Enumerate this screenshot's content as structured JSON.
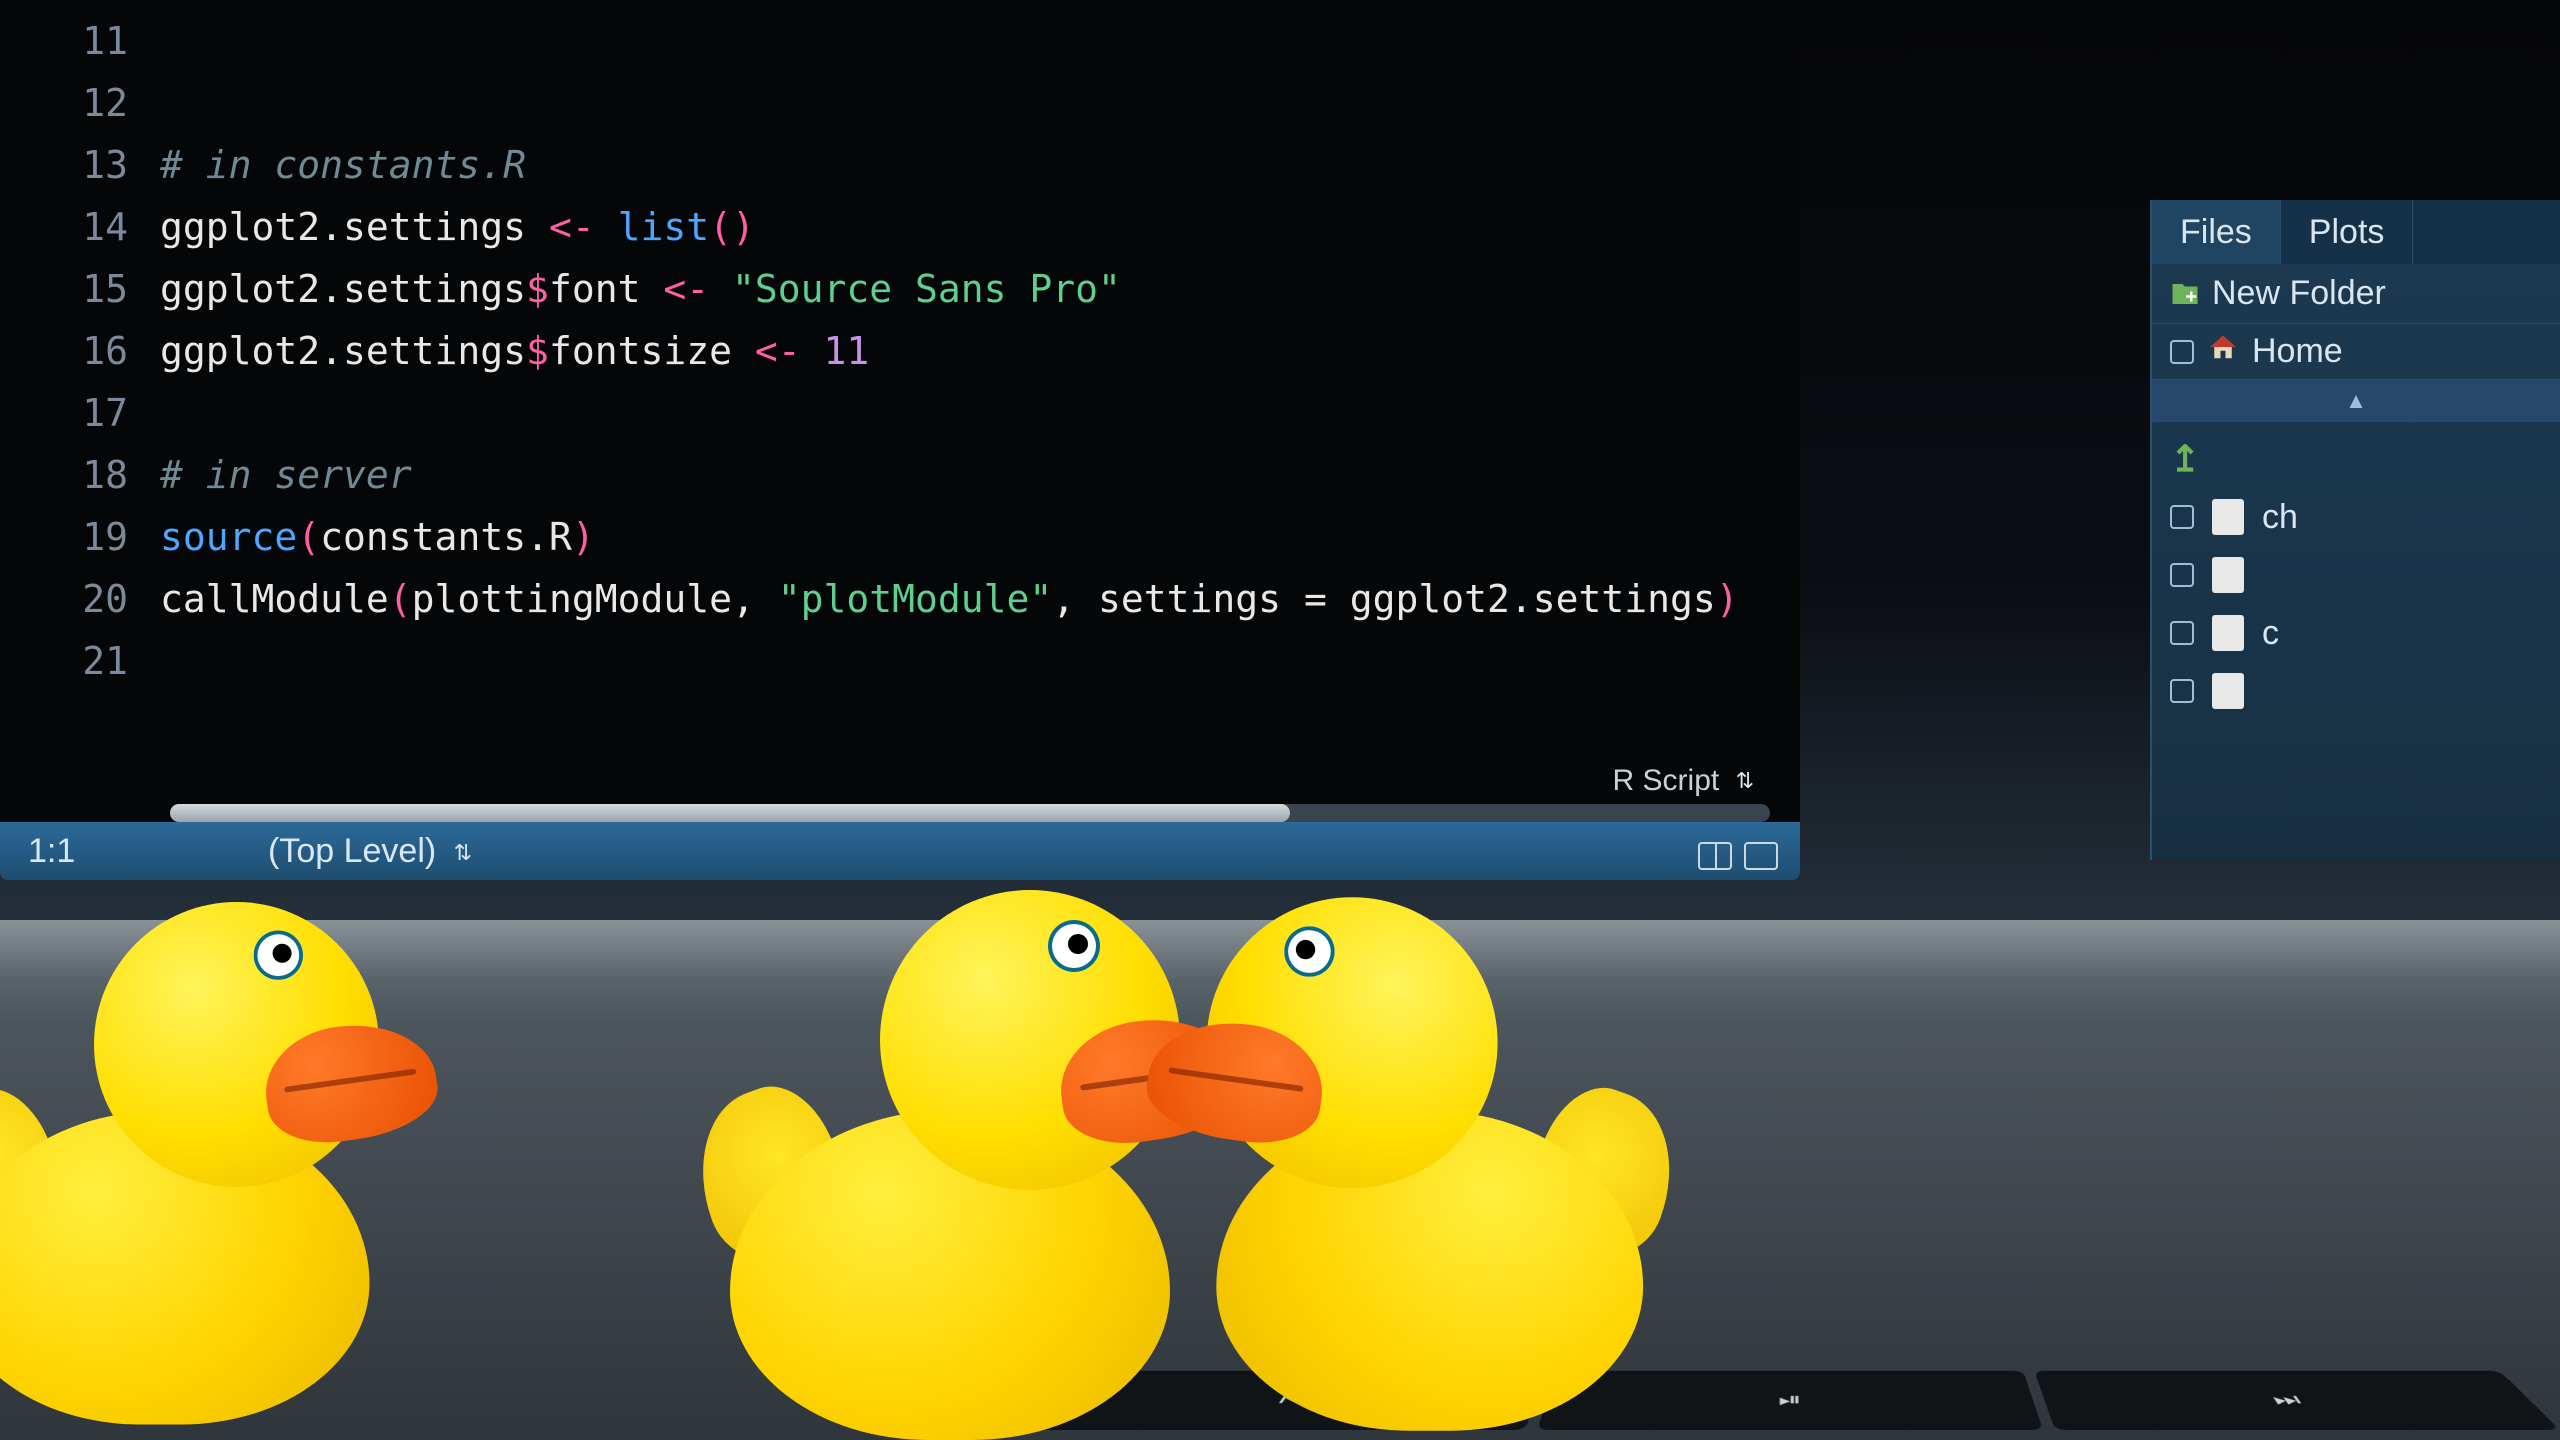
{
  "editor": {
    "line_start": 11,
    "lines": [
      {
        "n": 11,
        "tokens": []
      },
      {
        "n": 12,
        "tokens": []
      },
      {
        "n": 13,
        "tokens": [
          {
            "t": "# in constants.R",
            "c": "c-comment"
          }
        ]
      },
      {
        "n": 14,
        "tokens": [
          {
            "t": "ggplot2.settings ",
            "c": "c-ident"
          },
          {
            "t": "<-",
            "c": "c-assign"
          },
          {
            "t": " ",
            "c": "c-ident"
          },
          {
            "t": "list",
            "c": "c-func"
          },
          {
            "t": "()",
            "c": "c-paren"
          }
        ]
      },
      {
        "n": 15,
        "tokens": [
          {
            "t": "ggplot2.settings",
            "c": "c-ident"
          },
          {
            "t": "$",
            "c": "c-dollar"
          },
          {
            "t": "font ",
            "c": "c-ident"
          },
          {
            "t": "<-",
            "c": "c-assign"
          },
          {
            "t": " ",
            "c": "c-ident"
          },
          {
            "t": "\"Source Sans Pro\"",
            "c": "c-string"
          }
        ]
      },
      {
        "n": 16,
        "tokens": [
          {
            "t": "ggplot2.settings",
            "c": "c-ident"
          },
          {
            "t": "$",
            "c": "c-dollar"
          },
          {
            "t": "fontsize ",
            "c": "c-ident"
          },
          {
            "t": "<-",
            "c": "c-assign"
          },
          {
            "t": " ",
            "c": "c-ident"
          },
          {
            "t": "11",
            "c": "c-num"
          }
        ]
      },
      {
        "n": 17,
        "tokens": []
      },
      {
        "n": 18,
        "tokens": [
          {
            "t": "# in server",
            "c": "c-comment"
          }
        ]
      },
      {
        "n": 19,
        "tokens": [
          {
            "t": "source",
            "c": "c-func"
          },
          {
            "t": "(",
            "c": "c-paren"
          },
          {
            "t": "constants.R",
            "c": "c-ident"
          },
          {
            "t": ")",
            "c": "c-paren"
          }
        ]
      },
      {
        "n": 20,
        "tokens": [
          {
            "t": "callModule",
            "c": "c-ident"
          },
          {
            "t": "(",
            "c": "c-paren"
          },
          {
            "t": "plottingModule",
            "c": "c-ident"
          },
          {
            "t": ", ",
            "c": "c-ident"
          },
          {
            "t": "\"plotModule\"",
            "c": "c-string"
          },
          {
            "t": ", settings ",
            "c": "c-ident"
          },
          {
            "t": "=",
            "c": "c-eq"
          },
          {
            "t": " ggplot2.settings",
            "c": "c-ident"
          },
          {
            "t": ")",
            "c": "c-paren"
          }
        ]
      },
      {
        "n": 21,
        "tokens": []
      }
    ]
  },
  "statusbar": {
    "cursor": "1:1",
    "scope": "(Top Level)",
    "language": "R Script"
  },
  "files_pane": {
    "tabs": [
      "Files",
      "Plots"
    ],
    "active_tab": 0,
    "toolbar": {
      "new_folder": "New Folder"
    },
    "breadcrumb": "Home",
    "rows": [
      {
        "type": "up"
      },
      {
        "type": "file",
        "name": "ch"
      },
      {
        "type": "file",
        "name": ""
      },
      {
        "type": "file",
        "name": "c"
      },
      {
        "type": "file",
        "name": ""
      }
    ]
  },
  "keys": [
    "⏮",
    "⏯",
    "⏭"
  ]
}
